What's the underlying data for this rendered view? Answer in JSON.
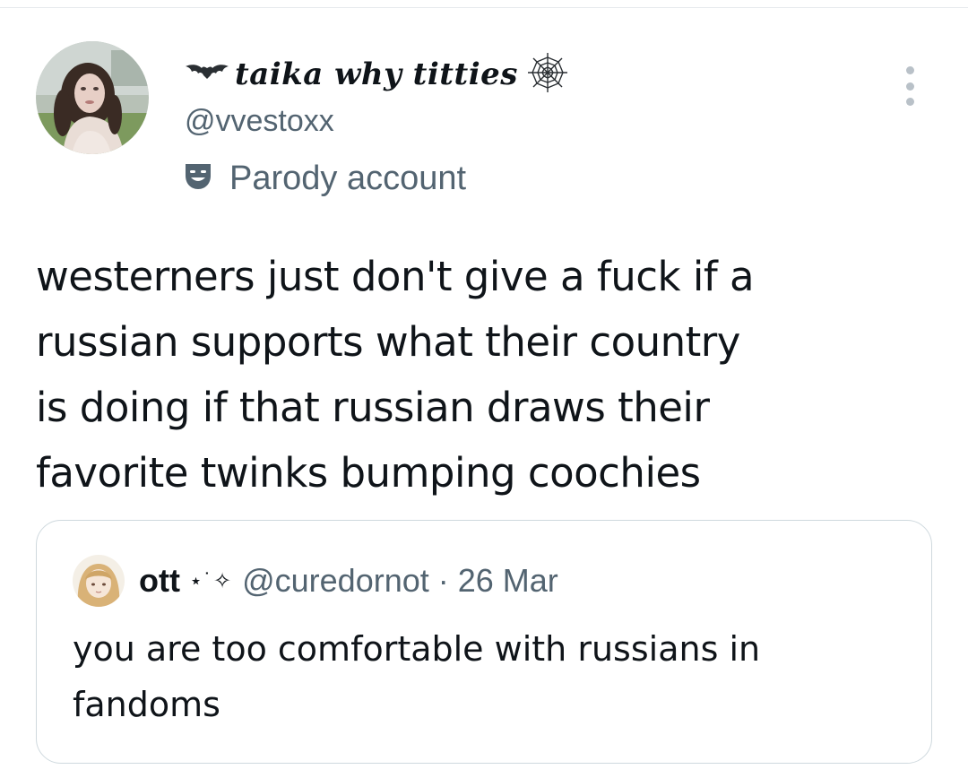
{
  "tweet": {
    "author": {
      "display_name": "taika why titties",
      "handle": "@vvestoxx",
      "label": "Parody account"
    },
    "text_lines": [
      "westerners just don't give a fuck if a",
      "russian supports what their country",
      "is doing if that russian draws their",
      "favorite twinks bumping coochies"
    ]
  },
  "quote": {
    "author": {
      "display_name": "ott",
      "decoration": "⋆˙✧",
      "handle": "@curedornot"
    },
    "separator": "·",
    "date": "26 Mar",
    "text_lines": [
      "you are too comfortable with russians in",
      "fandoms"
    ]
  },
  "icons": {
    "name_prefix": "bat-icon",
    "name_suffix": "spiderweb-icon",
    "label": "parody-mask-icon",
    "menu": "more-options-icon"
  },
  "colors": {
    "text_primary": "#0f1419",
    "text_secondary": "#536471",
    "border": "#cfd9de"
  }
}
